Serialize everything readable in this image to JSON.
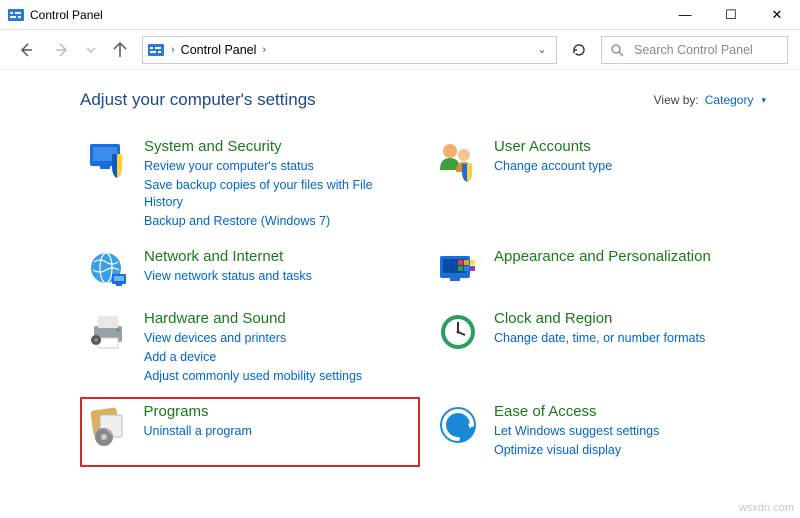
{
  "window": {
    "title": "Control Panel",
    "min_symbol": "—",
    "max_symbol": "☐",
    "close_symbol": "✕"
  },
  "nav": {
    "back_icon": "←",
    "forward_icon": "→",
    "up_icon": "↑",
    "breadcrumb_sep": "›",
    "breadcrumb": "Control Panel",
    "dropdown_symbol": "⌄",
    "refresh_symbol": "↻"
  },
  "search": {
    "placeholder": "Search Control Panel"
  },
  "header": {
    "heading": "Adjust your computer's settings",
    "viewby_label": "View by:",
    "viewby_value": "Category",
    "viewby_drop": "▾"
  },
  "categories": {
    "system": {
      "title": "System and Security",
      "links": [
        "Review your computer's status",
        "Save backup copies of your files with File History",
        "Backup and Restore (Windows 7)"
      ]
    },
    "network": {
      "title": "Network and Internet",
      "links": [
        "View network status and tasks"
      ]
    },
    "hardware": {
      "title": "Hardware and Sound",
      "links": [
        "View devices and printers",
        "Add a device",
        "Adjust commonly used mobility settings"
      ]
    },
    "programs": {
      "title": "Programs",
      "links": [
        "Uninstall a program"
      ]
    },
    "users": {
      "title": "User Accounts",
      "links": [
        "Change account type"
      ]
    },
    "appearance": {
      "title": "Appearance and Personalization",
      "links": []
    },
    "clock": {
      "title": "Clock and Region",
      "links": [
        "Change date, time, or number formats"
      ]
    },
    "ease": {
      "title": "Ease of Access",
      "links": [
        "Let Windows suggest settings",
        "Optimize visual display"
      ]
    }
  },
  "watermark": "wsxdn.com"
}
